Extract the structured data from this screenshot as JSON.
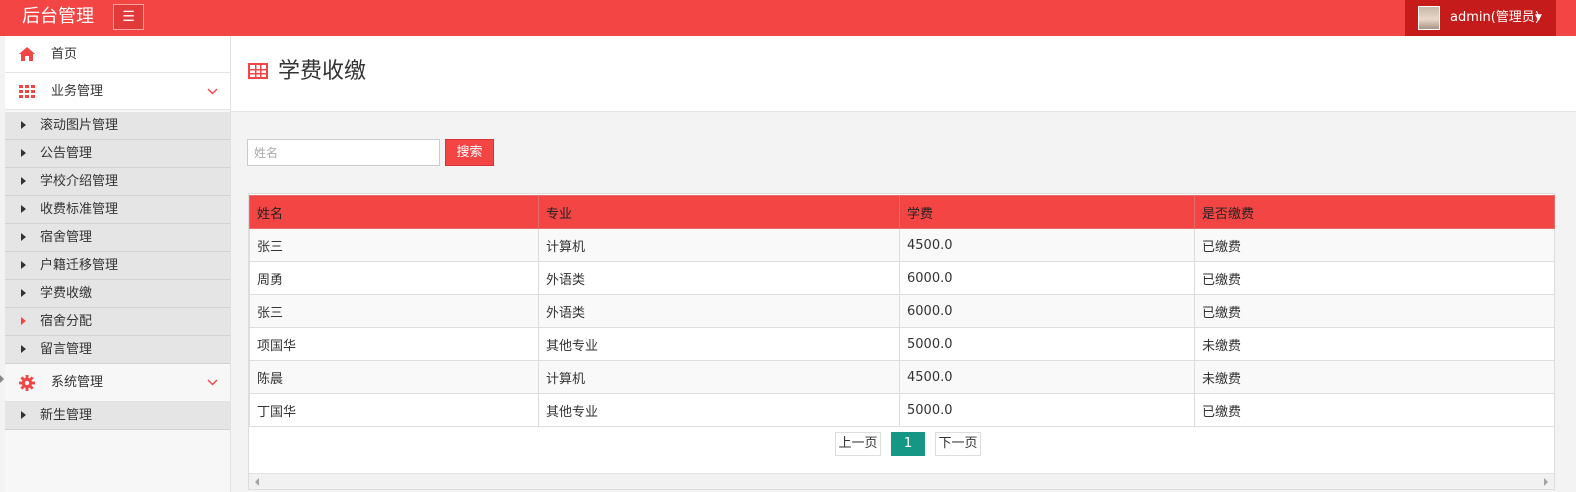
{
  "app": {
    "title": "后台管理",
    "menu_icon": "☰"
  },
  "user": {
    "name": "admin(管理员)",
    "caret": "▼"
  },
  "sidebar": {
    "home": {
      "label": "首页",
      "icon": "home-icon"
    },
    "business": {
      "label": "业务管理",
      "icon": "grid-icon",
      "chevron": "∨"
    },
    "business_items": [
      {
        "label": "滚动图片管理"
      },
      {
        "label": "公告管理"
      },
      {
        "label": "学校介绍管理"
      },
      {
        "label": "收费标准管理"
      },
      {
        "label": "宿舍管理"
      },
      {
        "label": "户籍迁移管理"
      },
      {
        "label": "学费收缴"
      },
      {
        "label": "宿舍分配"
      },
      {
        "label": "留言管理"
      }
    ],
    "system": {
      "label": "系统管理",
      "icon": "gear-icon",
      "chevron": "∨"
    },
    "system_items": [
      {
        "label": "新生管理"
      }
    ]
  },
  "main": {
    "title": "学费收缴",
    "search": {
      "placeholder": "姓名",
      "value": "",
      "button_label": "搜索"
    },
    "table": {
      "columns": [
        "姓名",
        "专业",
        "学费",
        "是否缴费"
      ],
      "rows": [
        [
          "张三",
          "计算机",
          "4500.0",
          "已缴费"
        ],
        [
          "周勇",
          "外语类",
          "6000.0",
          "已缴费"
        ],
        [
          "张三",
          "外语类",
          "6000.0",
          "已缴费"
        ],
        [
          "项国华",
          "其他专业",
          "5000.0",
          "未缴费"
        ],
        [
          "陈晨",
          "计算机",
          "4500.0",
          "未缴费"
        ],
        [
          "丁国华",
          "其他专业",
          "5000.0",
          "已缴费"
        ]
      ]
    },
    "pagination": {
      "prev_label": "上一页",
      "current_page": "1",
      "next_label": "下一页"
    }
  },
  "colors": {
    "accent": "#f44545",
    "accent_dark": "#c51b1b",
    "page_active": "#169684"
  }
}
